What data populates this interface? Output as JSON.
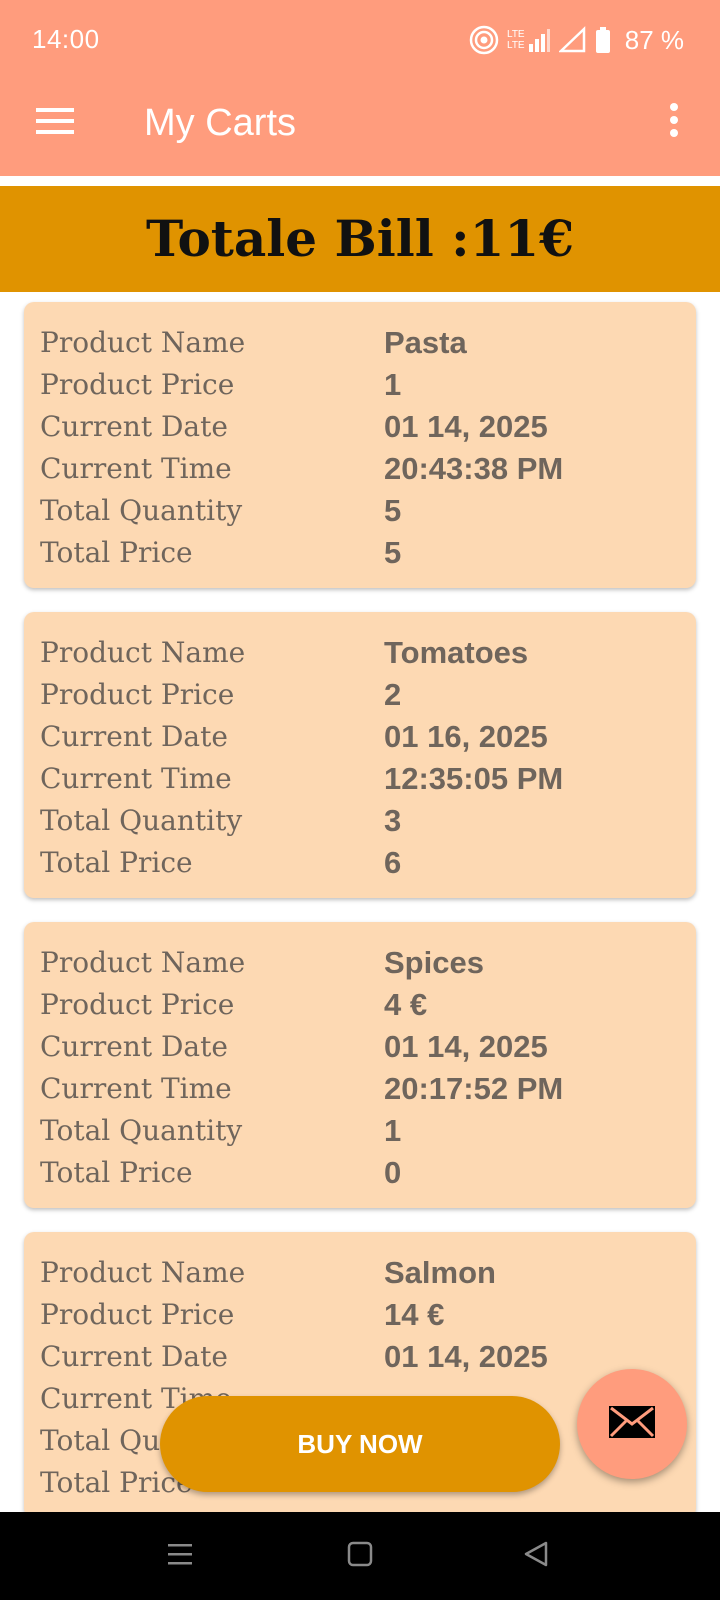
{
  "status_bar": {
    "time": "14:00",
    "battery_percent": "87 %",
    "icons": [
      "hotspot-icon",
      "lte-signal-icon",
      "signal-icon",
      "battery-icon"
    ]
  },
  "app_bar": {
    "title": "My Carts",
    "icons": [
      "menu-icon",
      "more-vert-icon"
    ]
  },
  "bill": {
    "text": "Totale Bill :11€"
  },
  "labels": {
    "product_name": "Product Name",
    "product_price": "Product Price",
    "current_date": "Current Date",
    "current_time": "Current Time",
    "total_quantity": "Total Quantity",
    "total_price": "Total Price"
  },
  "cart_items": [
    {
      "product_name": "Pasta",
      "product_price": "1",
      "current_date": "01 14, 2025",
      "current_time": "20:43:38 PM",
      "total_quantity": "5",
      "total_price": "5"
    },
    {
      "product_name": "Tomatoes",
      "product_price": "2",
      "current_date": "01 16, 2025",
      "current_time": "12:35:05 PM",
      "total_quantity": "3",
      "total_price": "6"
    },
    {
      "product_name": "Spices",
      "product_price": "4 €",
      "current_date": "01 14, 2025",
      "current_time": "20:17:52 PM",
      "total_quantity": "1",
      "total_price": "0"
    },
    {
      "product_name": "Salmon",
      "product_price": "14 €",
      "current_date": "01 14, 2025",
      "current_time": "",
      "total_quantity": "",
      "total_price": ""
    }
  ],
  "buy_button": {
    "label": "BUY NOW"
  },
  "fab": {
    "icon": "mail-icon"
  },
  "colors": {
    "app_bar": "#ff9c7d",
    "accent": "#e09300",
    "card": "#fdd9b3",
    "text": "#6f655c"
  },
  "nav_bar": {
    "icons": [
      "recents-icon",
      "home-icon",
      "back-icon"
    ]
  }
}
